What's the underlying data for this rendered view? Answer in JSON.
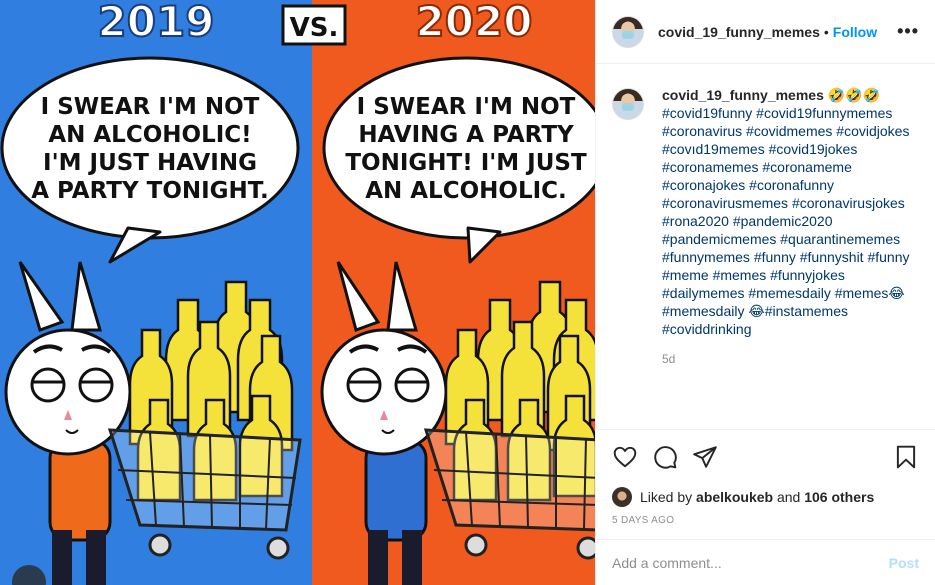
{
  "post": {
    "username": "covid_19_funny_memes",
    "follow_label": "Follow",
    "separator": "•",
    "more_label": "•••",
    "caption_emoji": "🤣🤣🤣",
    "caption_tags": "#covid19funny #covid19funnymemes #coronavirus #covidmemes #covidjokes #covıd19memes #covid19jokes #coronamemes #coronameme #coronajokes #coronafunny #coronavirusmemes #coronavirusjokes #rona2020 #pandemic2020 #pandemicmemes #quarantinememes #funnymemes #funny #funnyshit #funny #meme #memes #funnyjokes #dailymemes #memesdaily #memes😂#memesdaily 😂#instamemes #coviddrinking",
    "caption_age": "5d",
    "liked_by_prefix": "Liked by",
    "liked_by_user": "abelkoukeb",
    "liked_by_and": "and",
    "liked_by_others": "106 others",
    "date_label": "5 DAYS AGO",
    "comment_placeholder": "Add a comment...",
    "post_label": "Post"
  },
  "meme": {
    "left_year": "2019",
    "vs_label": "VS.",
    "right_year": "2020",
    "left_bubble": [
      "I SWEAR I'M NOT",
      "AN ALCOHOLIC!",
      "I'M JUST HAVING",
      "A PARTY TONIGHT."
    ],
    "right_bubble": [
      "I SWEAR I'M NOT",
      "HAVING A PARTY",
      "TONIGHT! I'M JUST",
      "AN ALCOHOLIC."
    ]
  },
  "colors": {
    "left_bg": "#2f7ee0",
    "right_bg": "#f05a1f",
    "accent": "#0095f6",
    "hashtag": "#00376b"
  },
  "icons": [
    "heart-icon",
    "comment-icon",
    "share-icon",
    "bookmark-icon"
  ]
}
